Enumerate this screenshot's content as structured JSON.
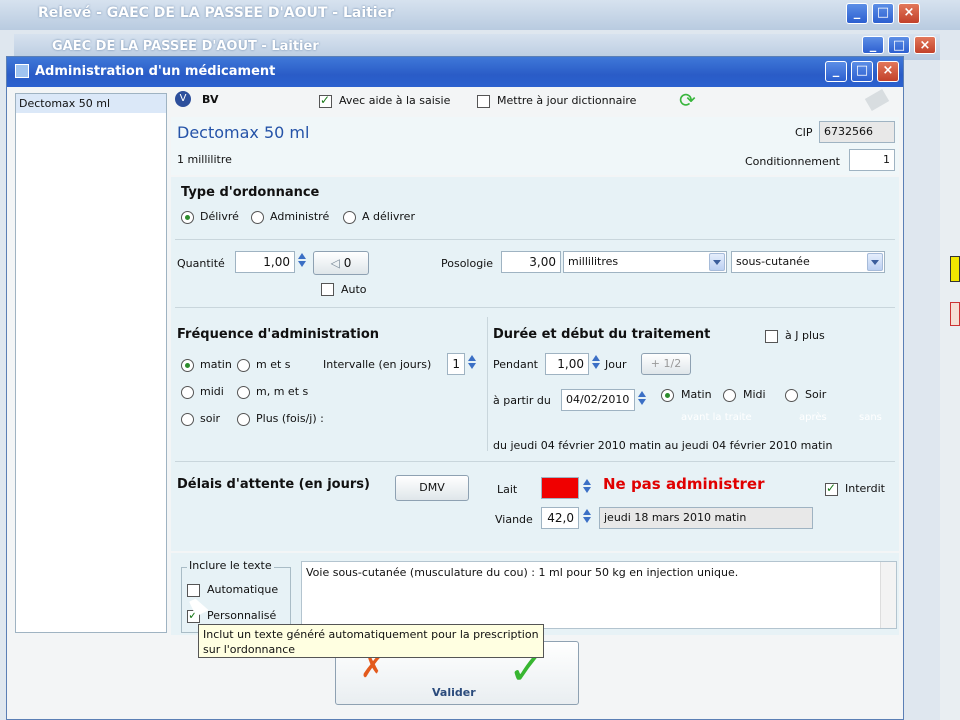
{
  "bg_windows": [
    {
      "title": "Relevé - GAEC DE LA PASSEE D'AOUT - Laitier"
    },
    {
      "title": "GAEC DE LA PASSEE D'AOUT - Laitier"
    }
  ],
  "dialog": {
    "title": "Administration d'un médicament",
    "sidebar": {
      "items": [
        "Dectomax 50 ml"
      ]
    },
    "toolbar": {
      "badge": "BV",
      "avec_aide": "Avec aide à la saisie",
      "maj_dico": "Mettre à jour dictionnaire"
    },
    "product": {
      "name": "Dectomax 50 ml",
      "unit": "1 millilitre",
      "cip_label": "CIP",
      "cip_value": "6732566",
      "cond_label": "Conditionnement",
      "cond_value": "1"
    },
    "ordonnance": {
      "title": "Type d'ordonnance",
      "options": [
        "Délivré",
        "Administré",
        "A délivrer"
      ]
    },
    "quantite": {
      "label": "Quantité",
      "value": "1,00",
      "btn_value": "0",
      "auto": "Auto"
    },
    "posologie": {
      "label": "Posologie",
      "value": "3,00",
      "unit": "millilitres",
      "voie": "sous-cutanée"
    },
    "frequence": {
      "title": "Fréquence d'administration",
      "options": [
        "matin",
        "m et s",
        "midi",
        "m, m et s",
        "soir",
        "Plus (fois/j) :"
      ],
      "intervalle_label": "Intervalle (en jours)",
      "intervalle_value": "1"
    },
    "duree": {
      "title": "Durée et début du traitement",
      "jplus": "à J plus",
      "pendant_label": "Pendant",
      "pendant_value": "1,00",
      "jour": "Jour",
      "half": "+ 1/2",
      "apartir_label": "à partir du",
      "date": "04/02/2010",
      "moments": [
        "Matin",
        "Midi",
        "Soir"
      ],
      "hints": [
        "avant la traite",
        "après",
        "sans"
      ],
      "summary": "du jeudi 04 février 2010 matin au jeudi 04 février 2010 matin"
    },
    "delais": {
      "title": "Délais d'attente (en jours)",
      "dmv": "DMV",
      "lait_label": "Lait",
      "lait_msg": "Ne pas administrer",
      "interdit": "Interdit",
      "viande_label": "Viande",
      "viande_value": "42,0",
      "viande_date": "jeudi 18 mars 2010 matin"
    },
    "inclure": {
      "title": "Inclure le texte",
      "automatique": "Automatique",
      "personnalise": "Personnalisé",
      "text": "Voie sous-cutanée (musculature du cou) : 1 ml pour 50 kg en injection unique."
    },
    "tooltip": "Inclut un texte généré automatiquement pour la prescription sur l'ordonnance",
    "valider": "Valider"
  },
  "colors": {
    "accent": "#2a5cc7",
    "panel": "#e7f2f6",
    "warning": "#e00000"
  }
}
